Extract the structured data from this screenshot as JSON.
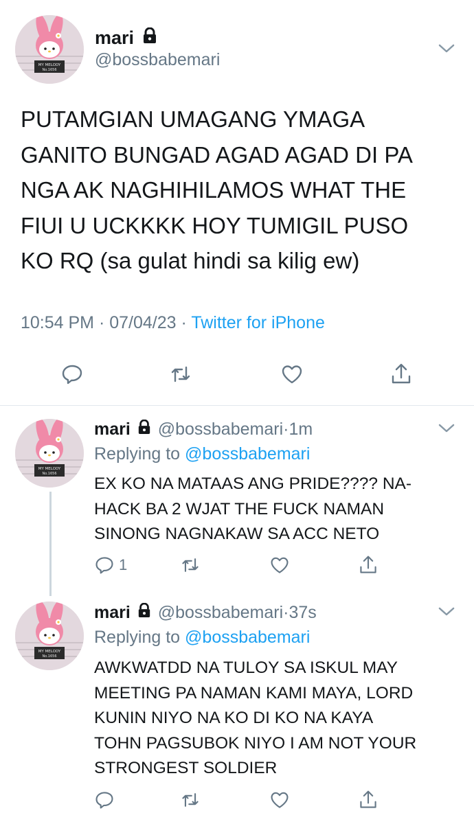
{
  "main_tweet": {
    "name": "mari",
    "handle": "@bossbabemari",
    "text": "PUTAMGIAN UMAGANG YMAGA\nGANITO BUNGAD AGAD AGAD DI PA\nNGA AK NAGHIHILAMOS WHAT THE\nFIUI U UCKKKK HOY TUMIGIL PUSO\nKO RQ (sa gulat hindi sa kilig ew)",
    "time": "10:54 PM",
    "date": "07/04/23",
    "source": "Twitter for iPhone",
    "sep": "·"
  },
  "replies": [
    {
      "name": "mari",
      "handle": "@bossbabemari",
      "time": "1m",
      "replying_label": "Replying to",
      "replying_to": "@bossbabemari",
      "text": "EX KO NA MATAAS ANG PRIDE???? NA-\nHACK BA 2 WJAT THE FUCK NAMAN\nSINONG NAGNAKAW SA ACC NETO",
      "reply_count": "1"
    },
    {
      "name": "mari",
      "handle": "@bossbabemari",
      "time": "37s",
      "replying_label": "Replying to",
      "replying_to": "@bossbabemari",
      "text": "AWKWATDD NA TULOY SA ISKUL MAY\nMEETING PA NAMAN KAMI MAYA, LORD\nKUNIN NIYO NA KO DI KO NA KAYA\nTOHN PAGSUBOK NIYO I AM NOT YOUR\nSTRONGEST SOLDIER",
      "reply_count": ""
    }
  ],
  "avatar_sign": {
    "line1": "MY MELODY",
    "line2": "No.1656"
  },
  "colors": {
    "text": "#14171a",
    "secondary": "#657786",
    "link": "#1da1f2",
    "divider": "#e1e8ed"
  },
  "icons": [
    "lock-icon",
    "chevron-down-icon",
    "reply-icon",
    "retweet-icon",
    "like-icon",
    "share-icon"
  ]
}
